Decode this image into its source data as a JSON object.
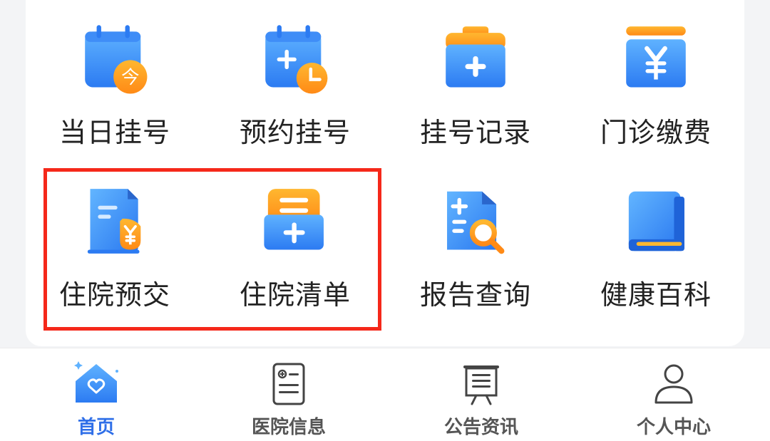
{
  "grid": [
    {
      "label": "当日挂号",
      "icon": "calendar-today-icon",
      "badge": "今"
    },
    {
      "label": "预约挂号",
      "icon": "calendar-add-clock-icon"
    },
    {
      "label": "挂号记录",
      "icon": "medical-kit-icon"
    },
    {
      "label": "门诊缴费",
      "icon": "yuan-payment-icon"
    },
    {
      "label": "住院预交",
      "icon": "document-yuan-icon"
    },
    {
      "label": "住院清单",
      "icon": "list-add-icon"
    },
    {
      "label": "报告查询",
      "icon": "report-search-icon"
    },
    {
      "label": "健康百科",
      "icon": "book-icon"
    }
  ],
  "tabs": [
    {
      "label": "首页",
      "icon": "home-heart-icon",
      "active": true
    },
    {
      "label": "医院信息",
      "icon": "hospital-info-icon",
      "active": false
    },
    {
      "label": "公告资讯",
      "icon": "notice-board-icon",
      "active": false
    },
    {
      "label": "个人中心",
      "icon": "user-icon",
      "active": false
    }
  ],
  "colors": {
    "blue_light": "#5fb2ff",
    "blue_dark": "#2c7bf2",
    "orange_light": "#ffb730",
    "orange_dark": "#ff8a16",
    "highlight_border": "#f5281a",
    "active_tab": "#2f6fe8"
  }
}
